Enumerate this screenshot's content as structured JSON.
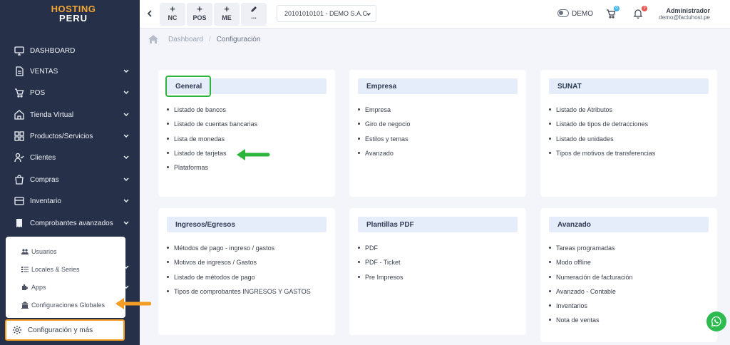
{
  "sidebar": {
    "logo_line1": "HOSTING",
    "logo_line2": "PERU",
    "items": [
      {
        "label": "DASHBOARD"
      },
      {
        "label": "VENTAS"
      },
      {
        "label": "POS"
      },
      {
        "label": "Tienda Virtual"
      },
      {
        "label": "Productos/Servicios"
      },
      {
        "label": "Clientes"
      },
      {
        "label": "Compras"
      },
      {
        "label": "Inventario"
      },
      {
        "label": "Comprobantes avanzados"
      }
    ],
    "submenu": [
      {
        "label": "Usuarios"
      },
      {
        "label": "Locales & Series"
      },
      {
        "label": "Apps"
      },
      {
        "label": "Configuraciones Globales"
      }
    ],
    "config_label": "Configuración y más"
  },
  "topbar": {
    "quick": [
      {
        "label": "NC"
      },
      {
        "label": "POS"
      },
      {
        "label": "ME"
      },
      {
        "label": "..."
      }
    ],
    "company": "20101010101 - DEMO S.A.C.",
    "demo_label": "DEMO",
    "cart_count": "0",
    "notif_count": "2",
    "user_name": "Administrador",
    "user_email": "demo@factuhost.pe"
  },
  "breadcrumb": {
    "home": "Dashboard",
    "current": "Configuración"
  },
  "cards": [
    {
      "title": "General",
      "items": [
        "Listado de bancos",
        "Listado de cuentas bancarias",
        "Lista de monedas",
        "Listado de tarjetas",
        "Plataformas"
      ]
    },
    {
      "title": "Empresa",
      "items": [
        "Empresa",
        "Giro de negocio",
        "Estilos y temas",
        "Avanzado"
      ]
    },
    {
      "title": "SUNAT",
      "items": [
        "Listado de Atributos",
        "Listado de tipos de detracciones",
        "Listado de unidades",
        "Tipos de motivos de transferencias"
      ]
    },
    {
      "title": "Ingresos/Egresos",
      "items": [
        "Métodos de pago - ingreso / gastos",
        "Motivos de ingresos / Gastos",
        "Listado de métodos de pago",
        "Tipos de comprobantes INGRESOS Y GASTOS"
      ]
    },
    {
      "title": "Plantillas PDF",
      "items": [
        "PDF",
        "PDF - Ticket",
        "Pre Impresos"
      ]
    },
    {
      "title": "Avanzado",
      "items": [
        "Tareas programadas",
        "Modo offline",
        "Numeración de facturación",
        "Avanzado - Contable",
        "Inventarios",
        "Nota de ventas"
      ]
    }
  ],
  "colors": {
    "sidebar_bg": "#263149",
    "accent_orange": "#f39c26",
    "accent_green": "#2bb53a",
    "card_header_bg": "#e6edfa",
    "cart_badge": "#3fb6e8",
    "notif_badge": "#e5534b"
  },
  "icons": {
    "dashboard": "monitor-icon",
    "ventas": "document-icon",
    "pos": "cart-icon",
    "tienda": "store-icon",
    "productos": "grid-icon",
    "clientes": "user-check-icon",
    "compras": "shopping-bag-icon",
    "inventario": "box-icon",
    "comprobantes": "receipt-icon",
    "config": "gear-icon"
  }
}
